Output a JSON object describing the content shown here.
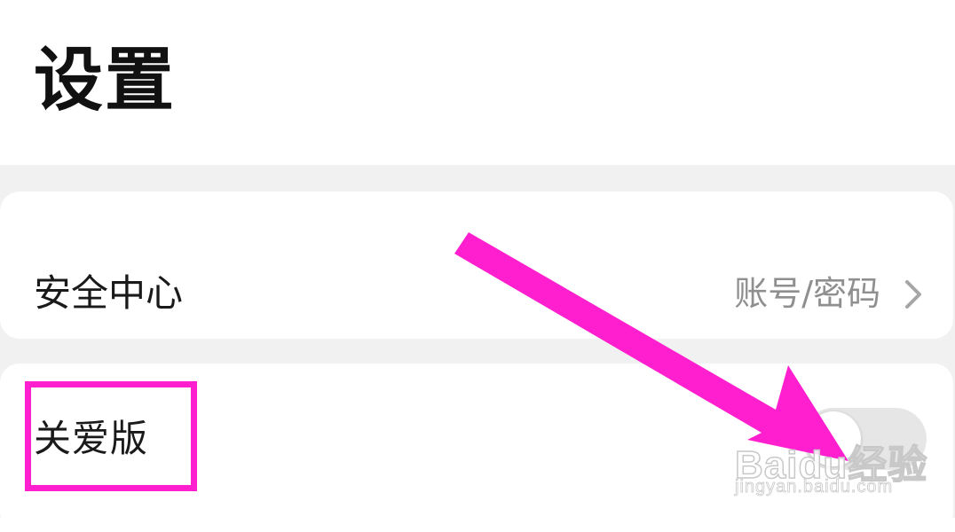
{
  "header": {
    "title": "设置"
  },
  "settings": {
    "security": {
      "label": "安全中心",
      "value": "账号/密码"
    },
    "care_mode": {
      "label": "关爱版",
      "toggle_on": false
    }
  },
  "icons": {
    "chevron": "chevron-right-icon",
    "arrow": "annotation-arrow-icon"
  },
  "colors": {
    "annotation": "#ff1fcf",
    "background": "#f1f1f1",
    "card": "#ffffff"
  },
  "watermark": {
    "logo": "Baidu经验",
    "url": "jingyan.baidu.com"
  }
}
